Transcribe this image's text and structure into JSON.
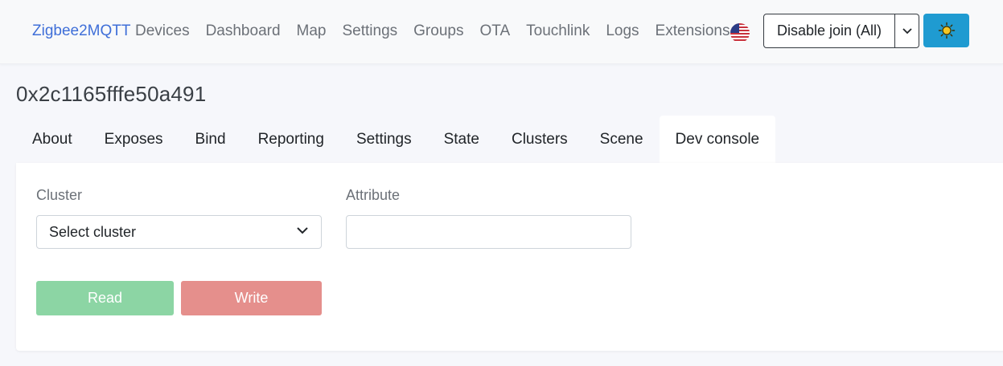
{
  "navbar": {
    "brand": "Zigbee2MQTT",
    "links": [
      "Devices",
      "Dashboard",
      "Map",
      "Settings",
      "Groups",
      "OTA",
      "Touchlink",
      "Logs",
      "Extensions"
    ],
    "flag_icon": "us-flag-icon",
    "join_button_label": "Disable join (All)",
    "theme_icon": "sun-icon",
    "accent_color": "#1f9bd1"
  },
  "device": {
    "title": "0x2c1165fffe50a491"
  },
  "tabs": [
    {
      "label": "About",
      "active": false
    },
    {
      "label": "Exposes",
      "active": false
    },
    {
      "label": "Bind",
      "active": false
    },
    {
      "label": "Reporting",
      "active": false
    },
    {
      "label": "Settings",
      "active": false
    },
    {
      "label": "State",
      "active": false
    },
    {
      "label": "Clusters",
      "active": false
    },
    {
      "label": "Scene",
      "active": false
    },
    {
      "label": "Dev console",
      "active": true
    }
  ],
  "dev_console": {
    "cluster_label": "Cluster",
    "cluster_value": "Select cluster",
    "attribute_label": "Attribute",
    "attribute_value": "",
    "read_label": "Read",
    "write_label": "Write",
    "read_color": "#8cd5a4",
    "write_color": "#e58f8c"
  }
}
